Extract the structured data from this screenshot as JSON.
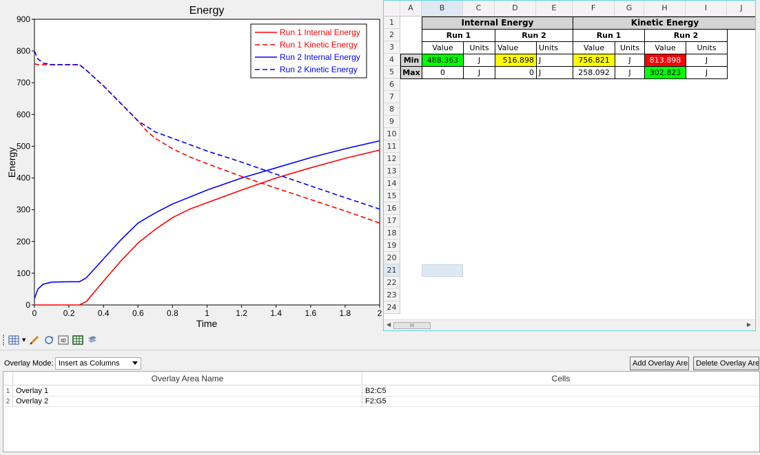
{
  "chart_data": {
    "type": "line",
    "title": "Energy",
    "xlabel": "Time",
    "ylabel": "Energy",
    "xlim": [
      0,
      2
    ],
    "ylim": [
      0,
      900
    ],
    "xticks": [
      "0",
      "0.2",
      "0.4",
      "0.6",
      "0.8",
      "1",
      "1.2",
      "1.4",
      "1.6",
      "1.8",
      "2"
    ],
    "yticks": [
      "0",
      "100",
      "200",
      "300",
      "400",
      "500",
      "600",
      "700",
      "800",
      "900"
    ],
    "legend_position": "top-right",
    "series": [
      {
        "name": "Run 1 Internal Energy",
        "color": "#ff0000",
        "dash": "solid",
        "x": [
          0,
          0.26,
          0.3,
          0.4,
          0.5,
          0.6,
          0.7,
          0.8,
          0.9,
          1.0,
          1.2,
          1.4,
          1.6,
          1.8,
          2.0
        ],
        "y": [
          0,
          0,
          10,
          75,
          138,
          195,
          238,
          275,
          302,
          322,
          362,
          400,
          432,
          462,
          488
        ]
      },
      {
        "name": "Run 1 Kinetic Energy",
        "color": "#ff0000",
        "dash": "dashed",
        "x": [
          0,
          0.02,
          0.1,
          0.26,
          0.3,
          0.4,
          0.5,
          0.6,
          0.65,
          0.7,
          0.8,
          0.9,
          1.0,
          1.2,
          1.4,
          1.6,
          1.8,
          2.0
        ],
        "y": [
          760,
          757,
          757,
          757,
          740,
          690,
          635,
          580,
          548,
          525,
          492,
          466,
          445,
          405,
          368,
          332,
          296,
          258
        ]
      },
      {
        "name": "Run 2 Internal Energy",
        "color": "#0000ff",
        "dash": "solid",
        "x": [
          0,
          0.02,
          0.05,
          0.1,
          0.2,
          0.26,
          0.3,
          0.4,
          0.5,
          0.6,
          0.7,
          0.8,
          0.9,
          1.0,
          1.2,
          1.4,
          1.6,
          1.8,
          2.0
        ],
        "y": [
          20,
          50,
          65,
          72,
          73,
          73,
          85,
          145,
          205,
          258,
          290,
          318,
          340,
          362,
          400,
          432,
          464,
          492,
          517
        ]
      },
      {
        "name": "Run 2 Kinetic Energy",
        "color": "#0000ff",
        "dash": "dashed",
        "x": [
          0,
          0.02,
          0.05,
          0.1,
          0.26,
          0.3,
          0.4,
          0.5,
          0.6,
          0.7,
          0.8,
          0.9,
          1.0,
          1.2,
          1.4,
          1.6,
          1.8,
          2.0
        ],
        "y": [
          800,
          775,
          762,
          757,
          757,
          740,
          690,
          635,
          580,
          545,
          525,
          505,
          485,
          450,
          412,
          375,
          338,
          302
        ]
      }
    ]
  },
  "spreadsheet": {
    "columns": [
      "A",
      "B",
      "C",
      "D",
      "E",
      "F",
      "G",
      "H",
      "I",
      "J"
    ],
    "selected_column": "B",
    "rows": [
      "1",
      "2",
      "3",
      "4",
      "5",
      "6",
      "7",
      "8",
      "9",
      "10",
      "11",
      "12",
      "13",
      "14",
      "15",
      "16",
      "17",
      "18",
      "19",
      "20",
      "21",
      "22",
      "23",
      "24"
    ],
    "selected_row": "21",
    "headers": {
      "internal_energy": "Internal Energy",
      "kinetic_energy": "Kinetic Energy",
      "run1": "Run 1",
      "run2": "Run 2",
      "value": "Value",
      "units": "Units"
    },
    "row_min": {
      "label": "Min",
      "ie_run1_value": "488.363",
      "ie_run1_units": "J",
      "ie_run2_value": "516.898",
      "ie_run2_units": "J",
      "ke_run1_value": "756.821",
      "ke_run1_units": "J",
      "ke_run2_value": "813.898",
      "ke_run2_units": "J"
    },
    "row_max": {
      "label": "Max",
      "ie_run1_value": "0",
      "ie_run1_units": "J",
      "ie_run2_value": "0",
      "ie_run2_units": "J",
      "ke_run1_value": "258.092",
      "ke_run1_units": "J",
      "ke_run2_value": "302.823",
      "ke_run2_units": "J"
    },
    "colors": {
      "green": "#00ff00",
      "yellow": "#ffff00",
      "red": "#ff0000",
      "header_gray": "#d4d4d4"
    }
  },
  "scrollbar": {
    "thumb_label": "III"
  },
  "overlay": {
    "mode_label": "Overlay Mode:",
    "mode_value": "Insert as Columns",
    "add_button": "Add Overlay Area",
    "delete_button": "Delete Overlay Area",
    "col_name": "Overlay Area Name",
    "col_cells": "Cells",
    "rows": [
      {
        "num": "1",
        "name": "Overlay 1",
        "cells": "B2:C5"
      },
      {
        "num": "2",
        "name": "Overlay 2",
        "cells": "F2:G5"
      }
    ]
  }
}
